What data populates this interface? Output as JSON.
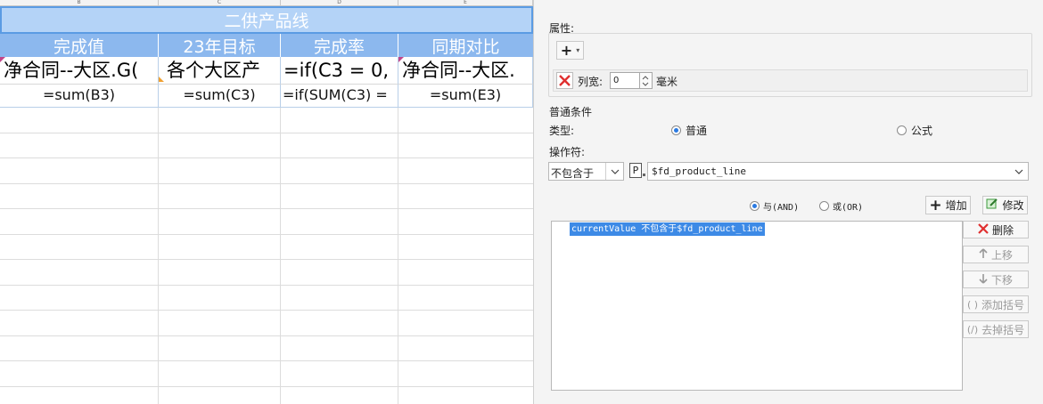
{
  "sheet": {
    "column_headers": [
      "B",
      "C",
      "D",
      "E"
    ],
    "merged_title": "二供产品线",
    "headers": [
      "完成值",
      "23年目标",
      "完成率",
      "同期对比"
    ],
    "row3": [
      "净合同--大区.G(",
      "各个大区产",
      "=if(C3 = 0,",
      "净合同--大区."
    ],
    "row4": [
      "=sum(B3)",
      "=sum(C3)",
      "=if(SUM(C3) =",
      "=sum(E3)"
    ]
  },
  "panel": {
    "properties_label": "属性:",
    "add_symbol": "+",
    "col_width_label": "列宽:",
    "col_width_value": "0",
    "unit_label": "毫米",
    "normal_condition_label": "普通条件",
    "type_label": "类型:",
    "type_normal": "普通",
    "type_formula": "公式",
    "operator_label": "操作符:",
    "operator_value": "不包含于",
    "param_badge": "P",
    "param_value": "$fd_product_line",
    "and_label": "与(AND)",
    "or_label": "或(OR)",
    "add_button": "增加",
    "modify_button": "修改",
    "condition_item": "currentValue 不包含于$fd_product_line",
    "delete_button": "删除",
    "move_up_button": "上移",
    "move_down_button": "下移",
    "add_bracket_button": "添加括号",
    "remove_bracket_button": "去掉括号"
  },
  "colors": {
    "header_blue": "#8cb8ee",
    "title_blue": "#b4d3f7",
    "selection_blue": "#3d8ae6",
    "delete_red": "#e03030"
  }
}
